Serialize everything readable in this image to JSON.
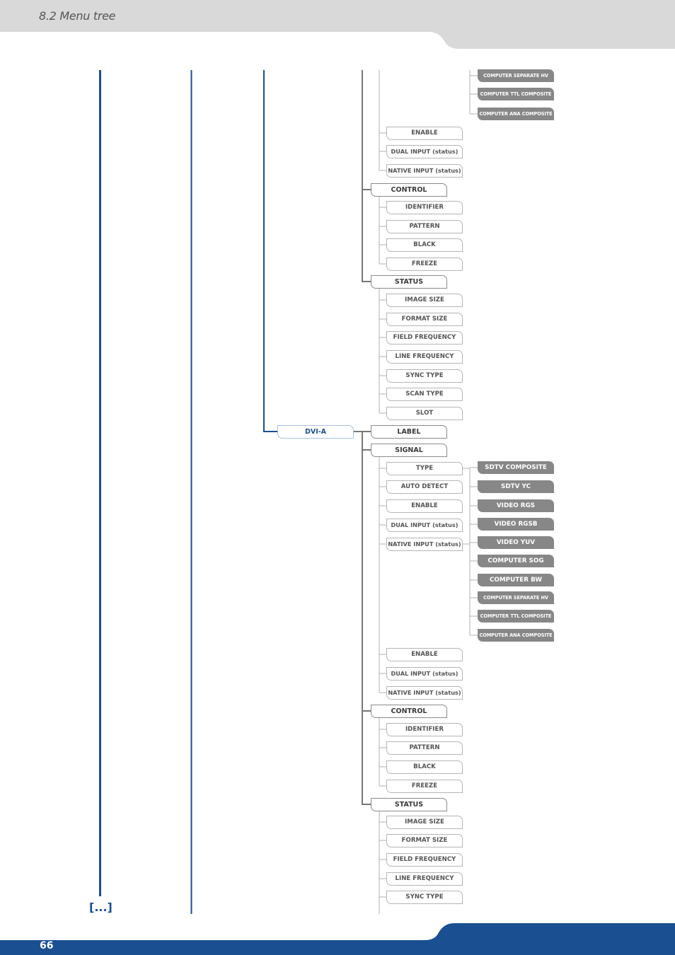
{
  "header": {
    "section_title": "8.2 Menu tree"
  },
  "footer": {
    "page_number": "66",
    "continuation_marker": "[...]"
  },
  "colors": {
    "brand_blue": "#1a4f92",
    "header_gray": "#d9d9d9",
    "option_box_gray": "#878787",
    "trunk_gray": "#777777",
    "branch_gray": "#b0b0b0"
  },
  "tree": {
    "upper_continuation": {
      "signal_type_options_tail": [
        "COMPUTER SEPARATE HV",
        "COMPUTER TTL COMPOSITE",
        "COMPUTER ANA COMPOSITE"
      ],
      "signal_items_tail": [
        "ENABLE",
        "DUAL INPUT (status)",
        "NATIVE INPUT (status)"
      ],
      "control": {
        "label": "CONTROL",
        "items": [
          "IDENTIFIER",
          "PATTERN",
          "BLACK",
          "FREEZE"
        ]
      },
      "status": {
        "label": "STATUS",
        "items": [
          "IMAGE SIZE",
          "FORMAT SIZE",
          "FIELD FREQUENCY",
          "LINE FREQUENCY",
          "SYNC TYPE",
          "SCAN TYPE",
          "SLOT"
        ]
      }
    },
    "dvi_a": {
      "label": "DVI-A",
      "label_node": "LABEL",
      "signal": {
        "label": "SIGNAL",
        "items_first": [
          "TYPE",
          "AUTO DETECT",
          "ENABLE",
          "DUAL INPUT (status)",
          "NATIVE INPUT (status)"
        ],
        "type_options": [
          "SDTV COMPOSITE",
          "SDTV YC",
          "VIDEO RGS",
          "VIDEO RGSB",
          "VIDEO YUV",
          "COMPUTER SOG",
          "COMPUTER BW",
          "COMPUTER SEPARATE HV",
          "COMPUTER TTL COMPOSITE",
          "COMPUTER ANA COMPOSITE"
        ],
        "items_second": [
          "ENABLE",
          "DUAL INPUT (status)",
          "NATIVE INPUT (status)"
        ]
      },
      "control": {
        "label": "CONTROL",
        "items": [
          "IDENTIFIER",
          "PATTERN",
          "BLACK",
          "FREEZE"
        ]
      },
      "status": {
        "label": "STATUS",
        "items": [
          "IMAGE SIZE",
          "FORMAT SIZE",
          "FIELD FREQUENCY",
          "LINE FREQUENCY",
          "SYNC TYPE"
        ]
      }
    }
  }
}
